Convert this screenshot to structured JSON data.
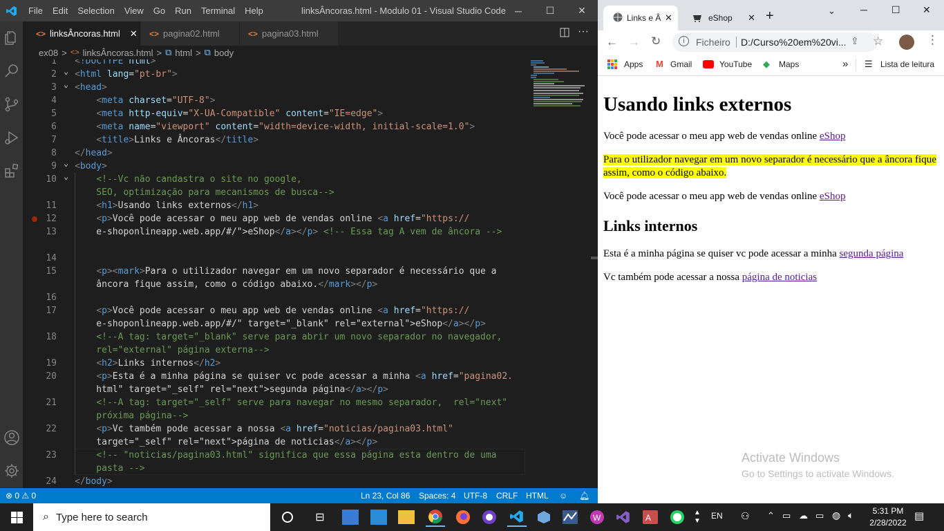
{
  "vscode": {
    "menu": [
      "File",
      "Edit",
      "Selection",
      "View",
      "Go",
      "Run",
      "Terminal",
      "Help"
    ],
    "window_title": "linksÂncoras.html - Modulo 01 - Visual Studio Code",
    "tabs": [
      {
        "label": "linksÂncoras.html",
        "active": true
      },
      {
        "label": "pagina02.html"
      },
      {
        "label": "pagina03.html"
      }
    ],
    "breadcrumb": [
      "ex08",
      ">",
      "linksÂncoras.html",
      ">",
      "html",
      ">",
      "body"
    ],
    "status": {
      "problems": "⊗ 0 ⚠ 0",
      "position": "Ln 23, Col 86",
      "spaces": "Spaces: 4",
      "encoding": "UTF-8",
      "eol": "CRLF",
      "language": "HTML"
    },
    "lines": [
      {
        "n": "1",
        "t": "<!DOCTYPE html>"
      },
      {
        "n": "2",
        "t": "<html lang=\"pt-br\">"
      },
      {
        "n": "3",
        "t": "<head>"
      },
      {
        "n": "4",
        "t": "    <meta charset=\"UTF-8\">"
      },
      {
        "n": "5",
        "t": "    <meta http-equiv=\"X-UA-Compatible\" content=\"IE=edge\">"
      },
      {
        "n": "6",
        "t": "    <meta name=\"viewport\" content=\"width=device-width, initial-scale=1.0\">"
      },
      {
        "n": "7",
        "t": "    <title>Links e Âncoras</title>"
      },
      {
        "n": "8",
        "t": "</head>"
      },
      {
        "n": "9",
        "t": "<body>"
      },
      {
        "n": "10",
        "t": "    <!--Vc não candastra o site no google,"
      },
      {
        "n": "",
        "t": "    SEO, optimização para mecanismos de busca-->"
      },
      {
        "n": "11",
        "t": "    <h1>Usando links externos</h1>"
      },
      {
        "n": "12",
        "t": "    <p>Você pode acessar o meu app web de vendas online <a href=\"https://"
      },
      {
        "n": "13",
        "t": "    e-shoponlineapp.web.app/#/\">eShop</a></p> <!-- Essa tag A vem de âncora -->"
      },
      {
        "n": "",
        "t": ""
      },
      {
        "n": "14",
        "t": ""
      },
      {
        "n": "15",
        "t": "    <p><mark>Para o utilizador navegar em um novo separador é necessário que a"
      },
      {
        "n": "",
        "t": "    âncora fique assim, como o código abaixo.</mark></p>"
      },
      {
        "n": "16",
        "t": ""
      },
      {
        "n": "17",
        "t": "    <p>Você pode acessar o meu app web de vendas online <a href=\"https://"
      },
      {
        "n": "",
        "t": "    e-shoponlineapp.web.app/#/\" target=\"_blank\" rel=\"external\">eShop</a></p>"
      },
      {
        "n": "18",
        "t": "    <!--A tag: target=\"_blank\" serve para abrir um novo separador no navegador,"
      },
      {
        "n": "",
        "t": "    rel=\"external\" página externa-->"
      },
      {
        "n": "19",
        "t": "    <h2>Links internos</h2>"
      },
      {
        "n": "20",
        "t": "    <p>Esta é a minha página se quiser vc pode acessar a minha <a href=\"pagina02."
      },
      {
        "n": "",
        "t": "    html\" target=\"_self\" rel=\"next\">segunda página</a></p>"
      },
      {
        "n": "21",
        "t": "    <!--A tag: target=\"_self\" serve para navegar no mesmo separador,  rel=\"next\""
      },
      {
        "n": "",
        "t": "    próxima página-->"
      },
      {
        "n": "22",
        "t": "    <p>Vc também pode acessar a nossa <a href=\"noticias/pagina03.html\""
      },
      {
        "n": "",
        "t": "    target=\"_self\" rel=\"next\">página de noticias</a></p>"
      },
      {
        "n": "23",
        "t": "    <!-- \"noticias/pagina03.html\" significa que essa página esta dentro de uma"
      },
      {
        "n": "",
        "t": "    pasta -->"
      },
      {
        "n": "24",
        "t": "</body>"
      },
      {
        "n": "25",
        "t": "</html>"
      }
    ]
  },
  "chrome": {
    "tabs": [
      {
        "label": "Links e Â"
      },
      {
        "label": "eShop"
      }
    ],
    "address": {
      "scheme": "Ficheiro",
      "url": "D:/Curso%20em%20vi..."
    },
    "bookmarks": [
      "Apps",
      "Gmail",
      "YouTube",
      "Maps"
    ],
    "reading_list": "Lista de leitura",
    "page": {
      "h1": "Usando links externos",
      "p1": "Você pode acessar o meu app web de vendas online ",
      "p1_link": "eShop",
      "p2_mark": "Para o utilizador navegar em um novo separador é necessário que a âncora fique assim, como o código abaixo.",
      "p3": "Você pode acessar o meu app web de vendas online ",
      "p3_link": "eShop",
      "h2": "Links internos",
      "p4": "Esta é a minha página se quiser vc pode acessar a minha ",
      "p4_link": "segunda página",
      "p5": "Vc também pode acessar a nossa ",
      "p5_link": "página de noticias"
    },
    "activate": {
      "title": "Activate Windows",
      "sub": "Go to Settings to activate Windows."
    }
  },
  "taskbar": {
    "search": "Type here to search",
    "lang": "EN",
    "time": "5:31 PM",
    "date": "2/28/2022"
  }
}
